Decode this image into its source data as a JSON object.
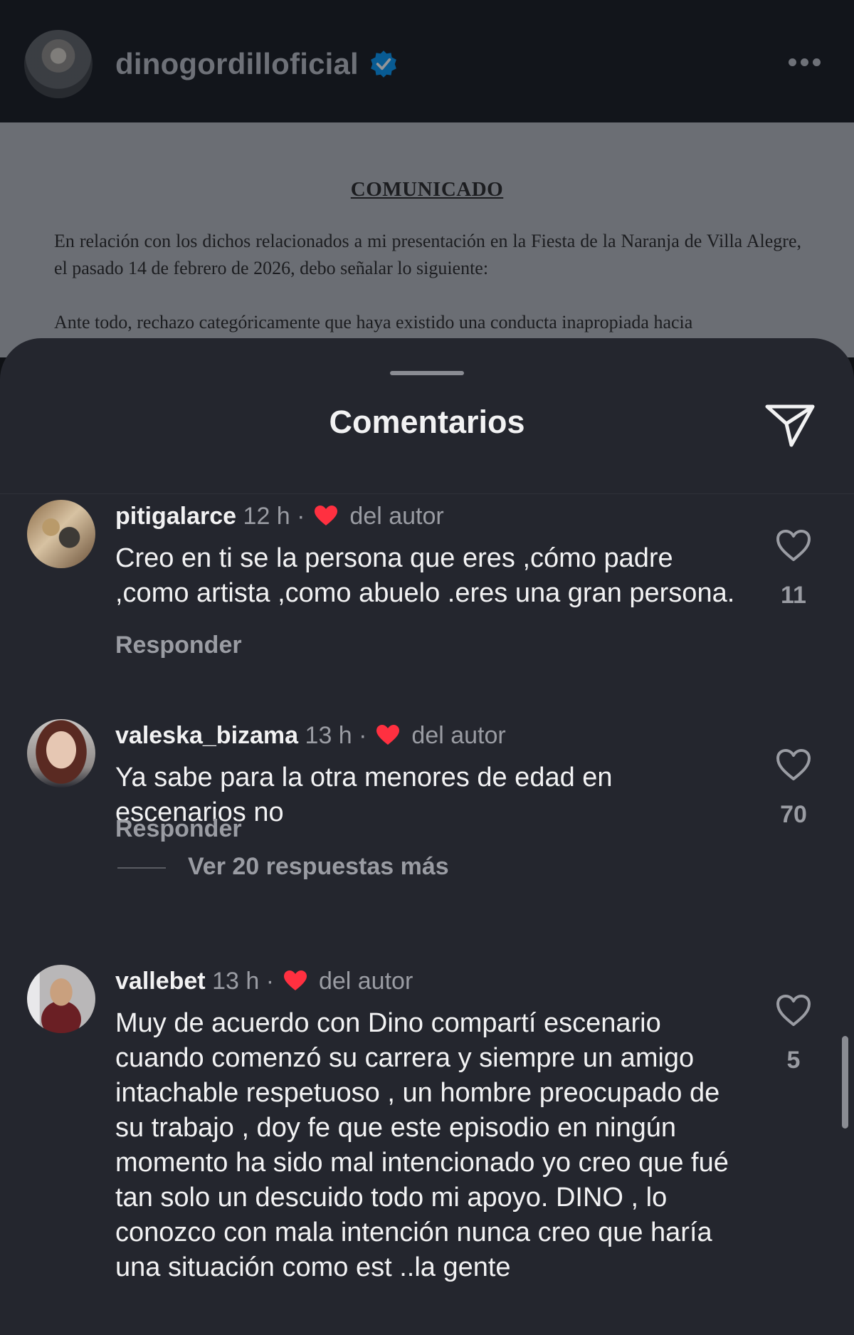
{
  "header": {
    "username": "dinogordilloficial",
    "verified": true
  },
  "document": {
    "title": "COMUNICADO",
    "paragraph1": "En relación con los dichos relacionados a mi presentación en la Fiesta de la Naranja de Villa Alegre, el pasado 14 de febrero de 2026, debo señalar lo siguiente:",
    "paragraph2": "Ante todo, rechazo categóricamente que haya existido una conducta inapropiada hacia"
  },
  "sheet": {
    "title": "Comentarios"
  },
  "comments": [
    {
      "username": "pitigalarce",
      "time": "12 h",
      "separator": "·",
      "author_like": "del autor",
      "text": "Creo en ti se la persona que eres ,cómo padre ,como artista ,como abuelo .eres una gran persona.",
      "reply": "Responder",
      "likes": "11"
    },
    {
      "username": "valeska_bizama",
      "time": "13 h",
      "separator": "·",
      "author_like": "del autor",
      "text": "Ya sabe para la otra menores de edad en escenarios no",
      "reply": "Responder",
      "likes": "70",
      "view_replies": "Ver 20 respuestas más"
    },
    {
      "username": "vallebet",
      "time": "13 h",
      "separator": "·",
      "author_like": "del autor",
      "text": "Muy de acuerdo con Dino  compartí escenario cuando comenzó su carrera y siempre un amigo intachable respetuoso , un hombre preocupado de su trabajo , doy fe que este episodio en ningún momento ha sido mal intencionado  yo creo que fué tan solo un descuido todo mi apoyo. DINO , lo conozco con mala intención nunca creo que haría una situación como est ..la gente",
      "likes": "5"
    }
  ],
  "colors": {
    "background": "#24262e",
    "text": "#f2f2f3",
    "muted": "#9a9ca3",
    "heart": "#ff3040",
    "verified": "#0095f6"
  },
  "icons": [
    "verified-icon",
    "more-icon",
    "send-icon",
    "heart-icon",
    "like-icon"
  ]
}
